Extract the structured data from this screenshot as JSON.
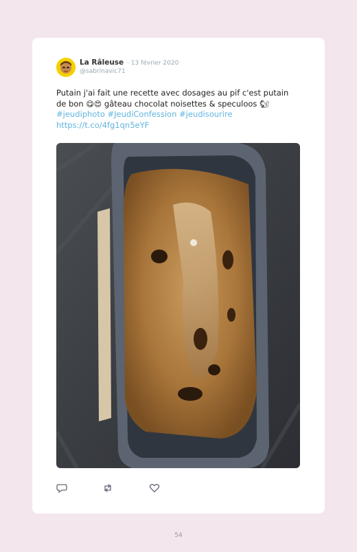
{
  "tweet": {
    "author_name": "La Râleuse",
    "separator_date": " · 13 février 2020",
    "handle": "@sabrinavic71",
    "text_line1": "Putain j'ai fait une recette avec dosages au pif c'est putain",
    "text_line2a": "de bon ",
    "emoji1": "😋",
    "emoji2": "😍",
    "text_line2b": " gâteau chocolat noisettes & speculoos ",
    "emoji3": "🐿",
    "hashtags": "#jeudiphoto #JeudiConfession #jeudisourire",
    "link": "https://t.co/4fg1qn5eYF"
  },
  "actions": {
    "reply_icon": "speech-bubble-icon",
    "retweet_icon": "retweet-icon",
    "like_icon": "heart-icon"
  },
  "page": {
    "number": "54"
  },
  "colors": {
    "background": "#f3e6ec",
    "card": "#ffffff",
    "link": "#5fb4e0",
    "muted": "#9aa7b0"
  }
}
